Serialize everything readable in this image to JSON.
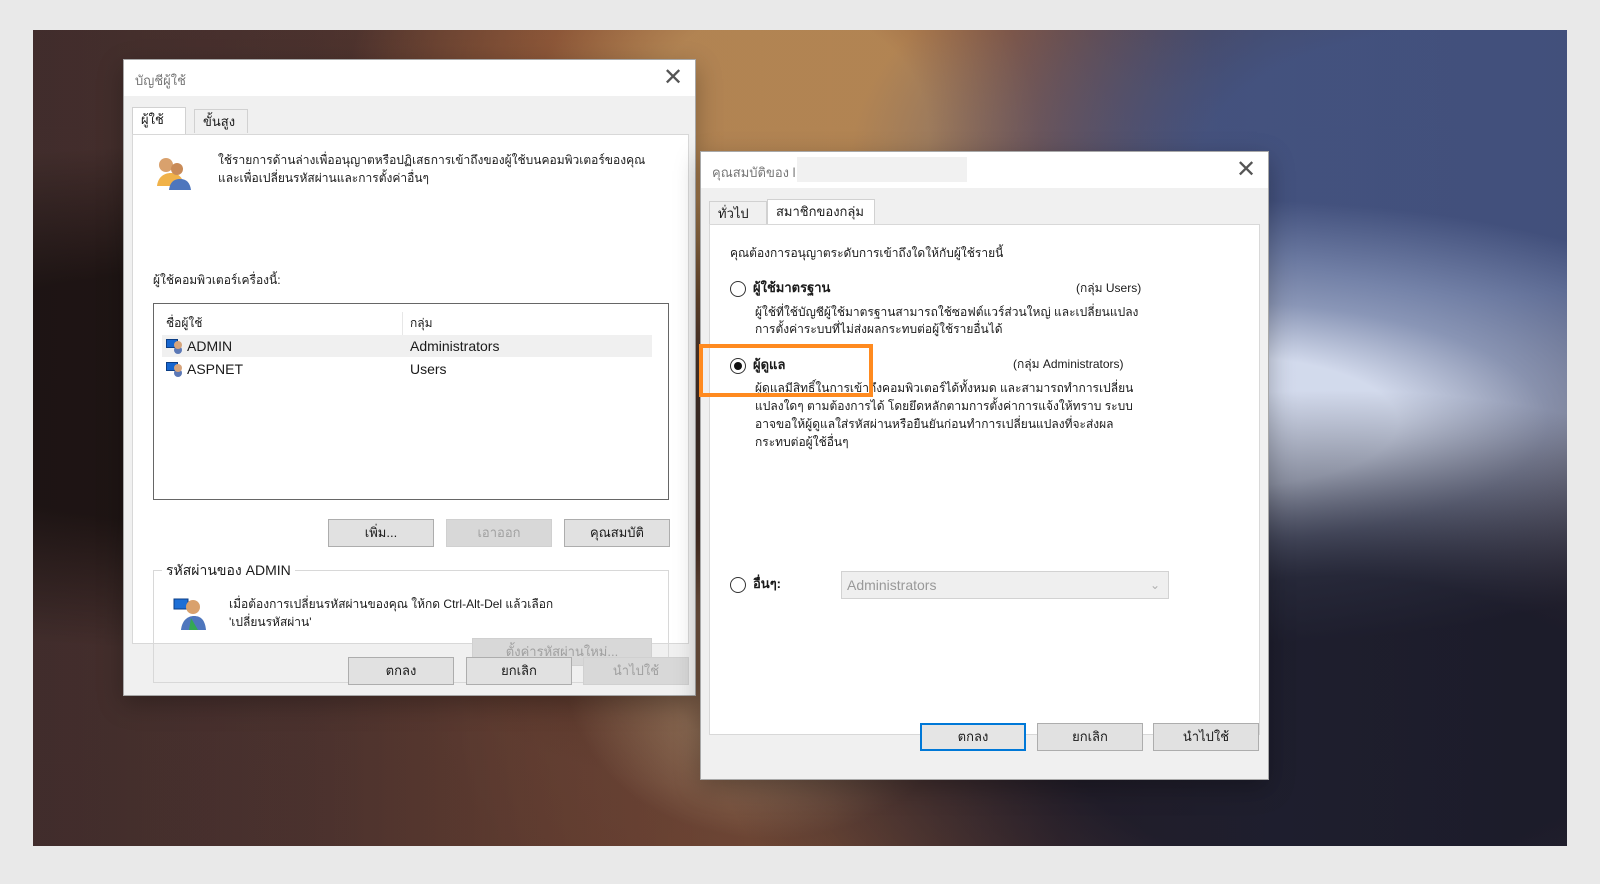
{
  "left_dialog": {
    "title": "บัญชีผู้ใช้",
    "close_symbol": "✕",
    "tabs": [
      "ผู้ใช้",
      "ขั้นสูง"
    ],
    "intro_line_1": "ใช้รายการด้านล่างเพื่ออนุญาตหรือปฏิเสธการเข้าถึงของผู้ใช้บนคอมพิวเตอร์ของคุณ",
    "intro_line_2": "และเพื่อเปลี่ยนรหัสผ่านและการตั้งค่าอื่นๆ",
    "users_label": "ผู้ใช้คอมพิวเตอร์เครื่องนี้:",
    "columns": [
      "ชื่อผู้ใช้",
      "กลุ่ม"
    ],
    "rows": [
      {
        "user": "ADMIN",
        "group": "Administrators"
      },
      {
        "user": "ASPNET",
        "group": "Users"
      }
    ],
    "buttons": {
      "add": "เพิ่ม...",
      "remove": "เอาออก",
      "properties": "คุณสมบัติ"
    },
    "password_section": {
      "legend": "รหัสผ่านของ ADMIN",
      "line_1": "เมื่อต้องการเปลี่ยนรหัสผ่านของคุณ ให้กด Ctrl-Alt-Del แล้วเลือก",
      "line_2": "'เปลี่ยนรหัสผ่าน'",
      "reset_button": "ตั้งค่ารหัสผ่านใหม่..."
    },
    "footer_buttons": {
      "ok": "ตกลง",
      "cancel": "ยกเลิก",
      "apply": "นำไปใช้"
    }
  },
  "right_dialog": {
    "title": "คุณสมบัติของ l",
    "close_symbol": "✕",
    "tabs": [
      "ทั่วไป",
      "สมาชิกของกลุ่ม"
    ],
    "prompt": "คุณต้องการอนุญาตระดับการเข้าถึงใดให้กับผู้ใช้รายนี้",
    "options": {
      "standard": {
        "label": "ผู้ใช้มาตรฐาน",
        "group": "(กลุ่ม Users)",
        "desc_1": "ผู้ใช้ที่ใช้บัญชีผู้ใช้มาตรฐานสามารถใช้ซอฟต์แวร์ส่วนใหญ่ และเปลี่ยนแปลง",
        "desc_2": "การตั้งค่าระบบที่ไม่ส่งผลกระทบต่อผู้ใช้รายอื่นได้"
      },
      "admin": {
        "label": "ผู้ดูแล",
        "group": "(กลุ่ม Administrators)",
        "desc_1": "ผู้ดูแลมีสิทธิ์ในการเข้าถึงคอมพิวเตอร์ได้ทั้งหมด และสามารถทำการเปลี่ยน",
        "desc_2": "แปลงใดๆ ตามต้องการได้ โดยยึดหลักตามการตั้งค่าการแจ้งให้ทราบ ระบบ",
        "desc_3": "อาจขอให้ผู้ดูแลใส่รหัสผ่านหรือยืนยันก่อนทำการเปลี่ยนแปลงที่จะส่งผล",
        "desc_4": "กระทบต่อผู้ใช้อื่นๆ"
      },
      "other": {
        "label": "อื่นๆ:",
        "selected_value": "Administrators",
        "arrow": "⌄"
      }
    },
    "footer_buttons": {
      "ok": "ตกลง",
      "cancel": "ยกเลิก",
      "apply": "นำไปใช้"
    }
  },
  "colors": {
    "selection_highlight": "#ff8a1f",
    "focus_blue": "#0078d7"
  },
  "icons": {
    "users": "users-icon",
    "user": "user-icon",
    "password": "password-user-icon",
    "radio_checked": "radio-selected-icon",
    "dropdown": "chevron-down-icon"
  }
}
